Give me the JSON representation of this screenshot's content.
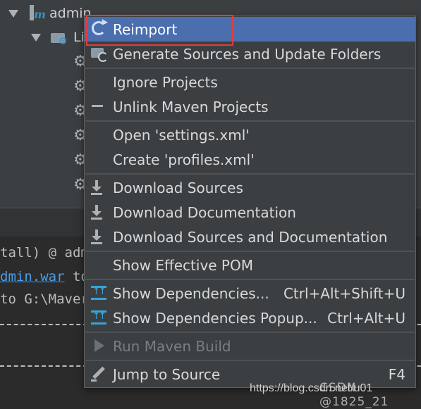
{
  "project_tree": {
    "root_label": "admin",
    "child_label": "Li"
  },
  "console": {
    "line1": "tall) @ adm",
    "line2_link": "dmin.war",
    "line2_rest": " to",
    "line3": "to G:\\Maver"
  },
  "menu": {
    "items": [
      {
        "id": "reimport",
        "label": "Reimport",
        "icon": "reimport-icon"
      },
      {
        "id": "generate",
        "label": "Generate Sources and Update Folders",
        "icon": "generate-sources-icon"
      },
      {
        "id": "ignore",
        "label": "Ignore Projects"
      },
      {
        "id": "unlink",
        "label": "Unlink Maven Projects",
        "icon": "minus-icon"
      },
      {
        "id": "open_settings",
        "label": "Open 'settings.xml'"
      },
      {
        "id": "create_profiles",
        "label": "Create 'profiles.xml'"
      },
      {
        "id": "download_sources",
        "label": "Download Sources",
        "icon": "download-icon"
      },
      {
        "id": "download_docs",
        "label": "Download Documentation",
        "icon": "download-icon"
      },
      {
        "id": "download_both",
        "label": "Download Sources and Documentation",
        "icon": "download-icon"
      },
      {
        "id": "effective_pom",
        "label": "Show Effective POM"
      },
      {
        "id": "show_deps",
        "label": "Show Dependencies...",
        "shortcut": "Ctrl+Alt+Shift+U",
        "icon": "dependencies-icon"
      },
      {
        "id": "show_deps_popup",
        "label": "Show Dependencies Popup...",
        "shortcut": "Ctrl+Alt+U",
        "icon": "dependencies-icon"
      },
      {
        "id": "run_build",
        "label": "Run Maven Build",
        "icon": "run-icon",
        "disabled": true
      },
      {
        "id": "jump_source",
        "label": "Jump to Source",
        "shortcut": "F4",
        "icon": "edit-icon"
      }
    ]
  },
  "watermark": {
    "url": "https://blog.csdn.net/u01",
    "overlay": "CSDN @1825_21"
  },
  "colors": {
    "selection": "#4b6eaf",
    "highlight_box": "#e43b3b",
    "menu_bg": "#3c3f41",
    "link": "#4a9ee8"
  }
}
